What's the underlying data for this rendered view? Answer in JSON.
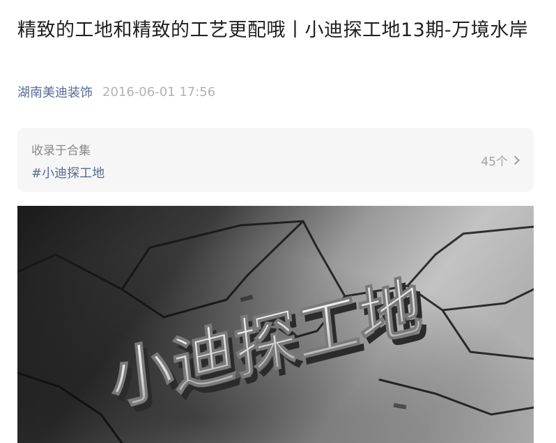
{
  "article": {
    "title": "精致的工地和精致的工艺更配哦丨小迪探工地13期-万境水岸",
    "author": "湖南美迪装饰",
    "date": "2016-06-01 17:56"
  },
  "collection": {
    "label": "收录于合集",
    "tag": "#小迪探工地",
    "count": "45个"
  },
  "cover": {
    "logo_text": "小迪探工地"
  },
  "icons": {
    "collection_arrow": "chevron-right-icon"
  }
}
